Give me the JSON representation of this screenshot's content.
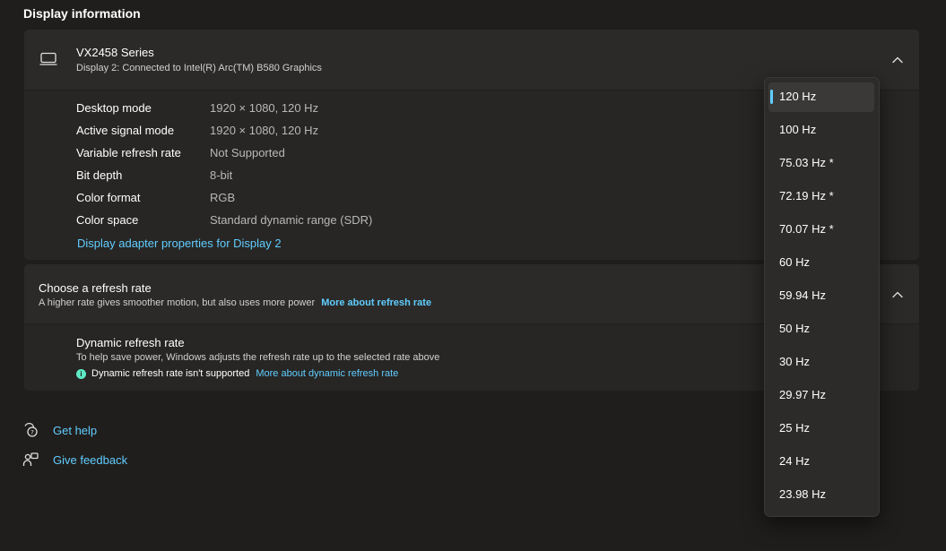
{
  "section_title": "Display information",
  "display": {
    "name": "VX2458 Series",
    "subtitle": "Display 2: Connected to Intel(R) Arc(TM) B580 Graphics",
    "rows": [
      {
        "label": "Desktop mode",
        "value": "1920 × 1080, 120 Hz"
      },
      {
        "label": "Active signal mode",
        "value": "1920 × 1080, 120 Hz"
      },
      {
        "label": "Variable refresh rate",
        "value": "Not Supported"
      },
      {
        "label": "Bit depth",
        "value": "8-bit"
      },
      {
        "label": "Color format",
        "value": "RGB"
      },
      {
        "label": "Color space",
        "value": "Standard dynamic range (SDR)"
      }
    ],
    "adapter_link": "Display adapter properties for Display 2"
  },
  "refresh": {
    "title": "Choose a refresh rate",
    "subtitle": "A higher rate gives smoother motion, but also uses more power",
    "more_link": "More about refresh rate",
    "dynamic": {
      "title": "Dynamic refresh rate",
      "subtitle": "To help save power, Windows adjusts the refresh rate up to the selected rate above",
      "info": "Dynamic refresh rate isn't supported",
      "info_link": "More about dynamic refresh rate"
    }
  },
  "help": {
    "get_help": "Get help",
    "give_feedback": "Give feedback"
  },
  "dropdown": {
    "selected": "120 Hz",
    "options": [
      "120 Hz",
      "100 Hz",
      "75.03 Hz *",
      "72.19 Hz *",
      "70.07 Hz *",
      "60 Hz",
      "59.94 Hz",
      "50 Hz",
      "30 Hz",
      "29.97 Hz",
      "25 Hz",
      "24 Hz",
      "23.98 Hz"
    ]
  },
  "colors": {
    "accent": "#60cdff",
    "background": "#201e1c",
    "card": "#2b2a28"
  },
  "icons": [
    "monitor-icon",
    "chevron-up-icon",
    "info-icon",
    "help-chat-icon",
    "feedback-icon"
  ]
}
